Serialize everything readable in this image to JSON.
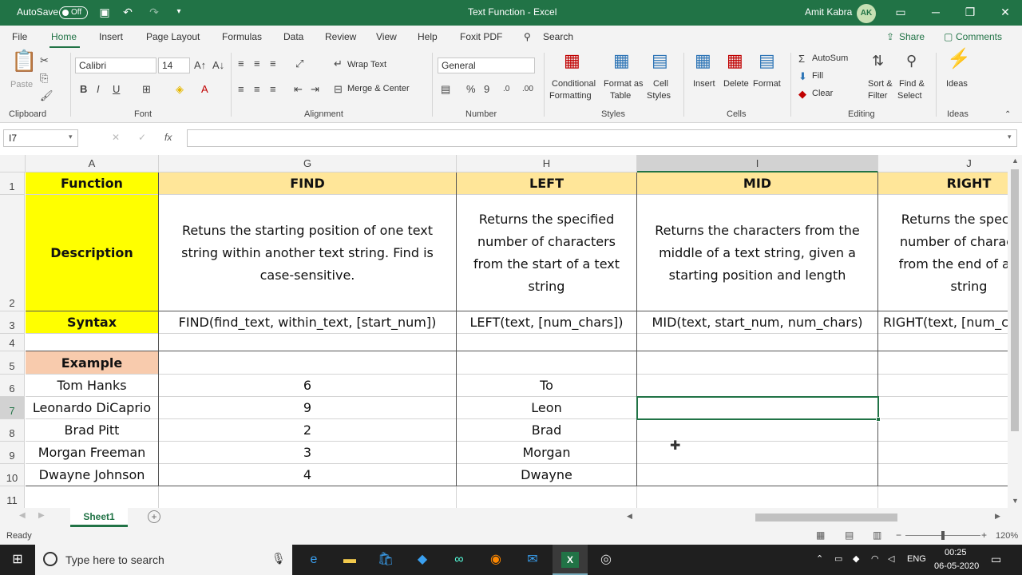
{
  "titlebar": {
    "autosave_label": "AutoSave",
    "autosave_state": "Off",
    "title": "Text Function  -  Excel",
    "user": "Amit Kabra",
    "user_initials": "AK"
  },
  "menu": {
    "items": [
      "File",
      "Home",
      "Insert",
      "Page Layout",
      "Formulas",
      "Data",
      "Review",
      "View",
      "Help",
      "Foxit PDF"
    ],
    "search": "Search",
    "share": "Share",
    "comments": "Comments"
  },
  "ribbon": {
    "paste": "Paste",
    "font_name": "Calibri",
    "font_size": "14",
    "wrap_text": "Wrap Text",
    "merge_center": "Merge & Center",
    "number_format": "General",
    "conditional": "Conditional",
    "formatting": "Formatting",
    "format_as": "Format as",
    "table": "Table",
    "cell": "Cell",
    "styles_btn": "Styles",
    "insert": "Insert",
    "delete": "Delete",
    "format": "Format",
    "autosum": "AutoSum",
    "fill": "Fill",
    "clear": "Clear",
    "sort_filter_1": "Sort &",
    "sort_filter_2": "Filter",
    "find_select_1": "Find &",
    "find_select_2": "Select",
    "ideas": "Ideas",
    "groups": {
      "clipboard": "Clipboard",
      "font": "Font",
      "alignment": "Alignment",
      "number": "Number",
      "styles": "Styles",
      "cells": "Cells",
      "editing": "Editing",
      "ideas": "Ideas"
    }
  },
  "formula_bar": {
    "name_box": "I7",
    "fx": "fx",
    "value": ""
  },
  "columns": [
    "A",
    "G",
    "H",
    "I",
    "J"
  ],
  "rows": [
    "1",
    "2",
    "3",
    "4",
    "5",
    "6",
    "7",
    "8",
    "9",
    "10",
    "11"
  ],
  "sheet": {
    "r1": [
      "Function",
      "FIND",
      "LEFT",
      "MID",
      "RIGHT"
    ],
    "r2": [
      "Description",
      "Retuns the starting position of one text string within another text string. Find is case-sensitive.",
      "Returns the specified number of characters from the start of a text string",
      "Returns the characters from the middle of a text string, given a starting position and length",
      "Returns the specified number of characters from the end of a text string"
    ],
    "r3": [
      "Syntax",
      "FIND(find_text, within_text, [start_num])",
      "LEFT(text, [num_chars])",
      "MID(text, start_num, num_chars)",
      "RIGHT(text, [num_chars])"
    ],
    "r5": [
      "Example",
      "",
      "",
      "",
      ""
    ],
    "data": [
      [
        "Tom Hanks",
        "6",
        "To"
      ],
      [
        "Leonardo DiCaprio",
        "9",
        "Leon"
      ],
      [
        "Brad Pitt",
        "2",
        "Brad"
      ],
      [
        "Morgan Freeman",
        "3",
        "Morgan"
      ],
      [
        "Dwayne Johnson",
        "4",
        "Dwayne"
      ]
    ]
  },
  "sheet_tabs": [
    "Sheet1"
  ],
  "status": {
    "ready": "Ready",
    "zoom": "120%"
  },
  "taskbar": {
    "search_placeholder": "Type here to search",
    "lang": "ENG",
    "time": "00:25",
    "date": "06-05-2020"
  },
  "colors": {
    "excel_green": "#217346",
    "yellow": "#ffff00",
    "orange": "#f8cbad",
    "tan": "#ffe699"
  }
}
